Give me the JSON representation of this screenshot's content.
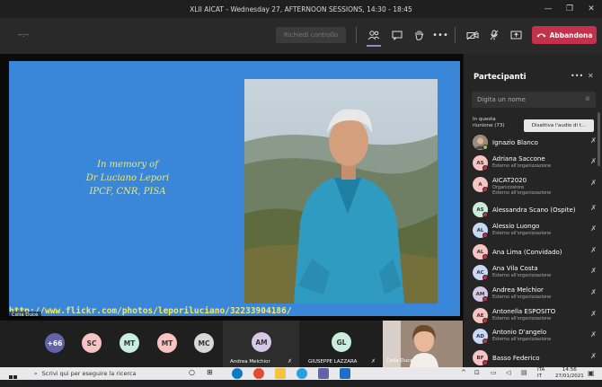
{
  "window": {
    "title": "XLII AICAT - Wednesday 27, AFTERNOON SESSIONS, 14:30 - 18:45",
    "controls": [
      "—",
      "❐",
      "✕"
    ]
  },
  "toolbar": {
    "timer": "--:--",
    "request_control": "Richiedi controllo",
    "leave": "Abbandona",
    "colors": {
      "leave": "#c4314b",
      "bar": "#292929"
    }
  },
  "slide": {
    "memory_lines": [
      "In memory of",
      "Dr Luciano Lepori",
      "IPCF, CNR, PISA"
    ],
    "url": "http://www.flickr.com/photos/leporiluciano/32233904186/",
    "presenter": "Celia Duce",
    "colors": {
      "background": "#3a86d8",
      "text": "#f2e96a"
    }
  },
  "strip": {
    "more_count": "+66",
    "avatars": [
      {
        "initials": "SC",
        "color": "#f7c3c3"
      },
      {
        "initials": "MT",
        "color": "#c9eedd"
      },
      {
        "initials": "MT",
        "color": "#f7c3c3"
      },
      {
        "initials": "MC",
        "color": "#d8d8d8"
      }
    ],
    "tiles": [
      {
        "initials": "AM",
        "name": "Andrea Melchior",
        "color": "#d8c8e8"
      },
      {
        "initials": "GL",
        "name": "GIUSEPPE LAZZARA",
        "color": "#c9eedd"
      },
      {
        "name": "Celia Duce"
      }
    ]
  },
  "panel": {
    "title": "Partecipanti",
    "search_placeholder": "Digita un nome",
    "meeting_label": "In questa riunione (73)",
    "mute_all": "Disattiva l'audio di t...",
    "participants": [
      {
        "initials": "",
        "name": "Ignazio Blanco",
        "sub": [],
        "color": "#8a8a8a",
        "photo": true
      },
      {
        "initials": "AS",
        "name": "Adriana Saccone",
        "sub": [
          "Esterno all'organizzazione"
        ],
        "color": "#f7c3c3"
      },
      {
        "initials": "A",
        "name": "AICAT2020",
        "sub": [
          "Organizzatore",
          "Esterno all'organizzazione"
        ],
        "color": "#f7c3c3"
      },
      {
        "initials": "AS",
        "name": "Alessandra Scano (Ospite)",
        "sub": [],
        "color": "#c9eedd"
      },
      {
        "initials": "AL",
        "name": "Alessio Luongo",
        "sub": [
          "Esterno all'organizzazione"
        ],
        "color": "#c8d8f5"
      },
      {
        "initials": "AL",
        "name": "Ana Lima (Convidado)",
        "sub": [],
        "color": "#f7c3c3"
      },
      {
        "initials": "AC",
        "name": "Ana Vila Costa",
        "sub": [
          "Esterno all'organizzazione"
        ],
        "color": "#c8d8f5"
      },
      {
        "initials": "AM",
        "name": "Andrea Melchior",
        "sub": [
          "Esterno all'organizzazione"
        ],
        "color": "#d8c8e8"
      },
      {
        "initials": "AE",
        "name": "Antonella ESPOSITO",
        "sub": [
          "Esterno all'organizzazione"
        ],
        "color": "#f7c3c3"
      },
      {
        "initials": "AD",
        "name": "Antonio D'angelo",
        "sub": [
          "Esterno all'organizzazione"
        ],
        "color": "#c8d8f5"
      },
      {
        "initials": "BF",
        "name": "Basso Federico",
        "sub": [],
        "color": "#f7c3c3"
      }
    ]
  },
  "taskbar": {
    "search_placeholder": "Scrivi qui per eseguire la ricerca",
    "lang": "ITA",
    "lang2": "IT",
    "time": "14:56",
    "date": "27/01/2021"
  }
}
